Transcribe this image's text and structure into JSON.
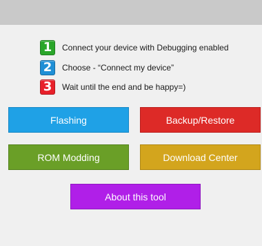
{
  "steps": [
    {
      "num": "1",
      "text": "Connect your device with Debugging enabled",
      "color": "#2aa62a"
    },
    {
      "num": "2",
      "text": "Choose - “Connect my device”",
      "color": "#1f8fd6"
    },
    {
      "num": "3",
      "text": "Wait until the end and be happy=)",
      "color": "#e8202a"
    }
  ],
  "buttons": {
    "flashing": "Flashing",
    "backup_restore": "Backup/Restore",
    "rom_modding": "ROM Modding",
    "download_center": "Download Center",
    "about": "About this tool"
  },
  "colors": {
    "flashing": "#1fa1e6",
    "backup_restore": "#dd2a27",
    "rom_modding": "#6a9f27",
    "download_center": "#d3a51d",
    "about": "#b01fe8"
  }
}
